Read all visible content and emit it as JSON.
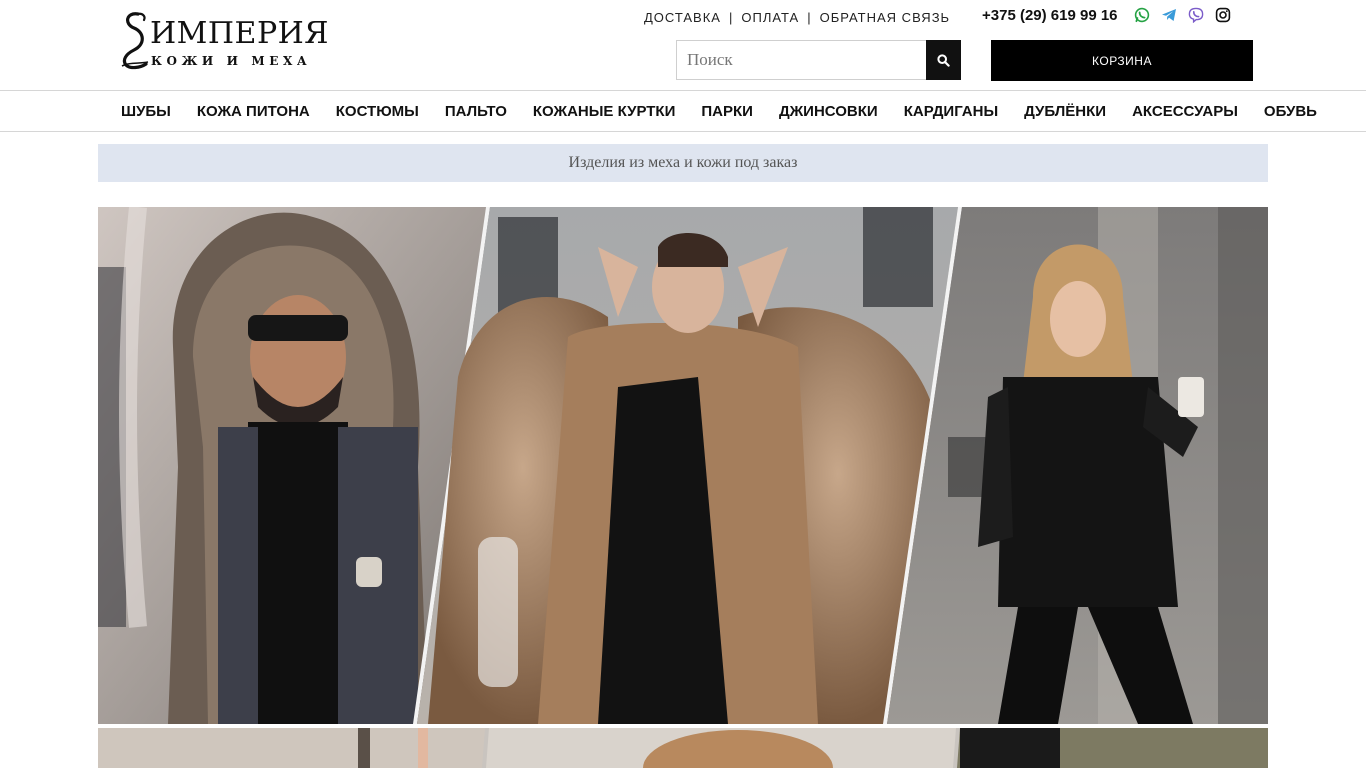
{
  "logo": {
    "title": "ИМПЕРИЯ",
    "subtitle": "КОЖИ И МЕХА"
  },
  "top_links": [
    "ДОСТАВКА",
    "ОПЛАТА",
    "ОБРАТНАЯ СВЯЗЬ"
  ],
  "top_links_separator": "|",
  "phone": "+375 (29) 619 99 16",
  "socials": [
    {
      "icon": "whatsapp-icon",
      "color": "#25a244"
    },
    {
      "icon": "telegram-icon",
      "color": "#3a9bd9"
    },
    {
      "icon": "viber-icon",
      "color": "#7b5cc9"
    },
    {
      "icon": "instagram-icon",
      "color": "#111111"
    }
  ],
  "search": {
    "placeholder": "Поиск",
    "value": "",
    "button_icon": "search-icon"
  },
  "cart": {
    "label": "КОРЗИНА"
  },
  "nav": {
    "items": [
      "ШУБЫ",
      "КОЖА ПИТОНА",
      "КОСТЮМЫ",
      "ПАЛЬТО",
      "КОЖАНЫЕ КУРТКИ",
      "ПАРКИ",
      "ДЖИНСОВКИ",
      "КАРДИГАНЫ",
      "ДУБЛЁНКИ",
      "АКСЕССУАРЫ",
      "ОБУВЬ"
    ]
  },
  "promo": {
    "text": "Изделия из меха и кожи под заказ"
  },
  "colors": {
    "accent": "#000000",
    "promo_bg": "#dfe5f0",
    "border": "#d6d6d6"
  }
}
